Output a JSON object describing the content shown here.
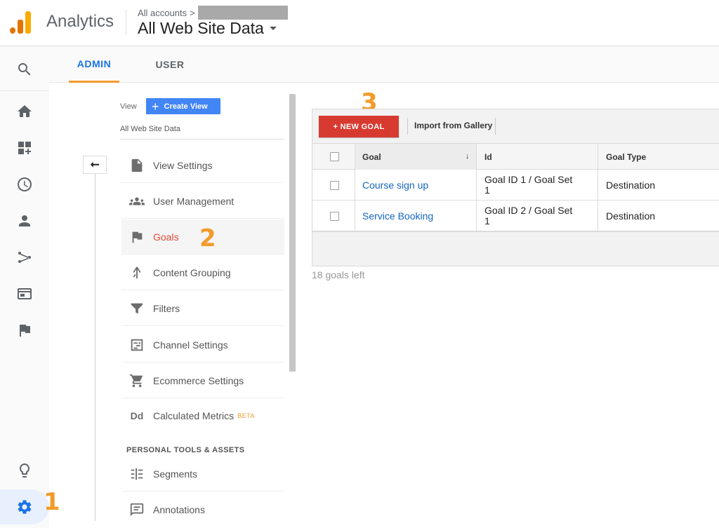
{
  "header": {
    "app_name": "Analytics",
    "breadcrumb": "All accounts",
    "breadcrumb_chevron": ">",
    "property_name": "All Web Site Data"
  },
  "brand_colors": {
    "logo_dark": "#e37400",
    "logo_light": "#f9ab00",
    "accent_blue": "#1a73e8",
    "new_goal_red": "#d73b30",
    "step_orange": "#f29b2b"
  },
  "rail": {
    "items": [
      {
        "icon": "search-icon"
      },
      {
        "icon": "home-icon"
      },
      {
        "icon": "customization-icon"
      },
      {
        "icon": "realtime-clock-icon"
      },
      {
        "icon": "audience-person-icon"
      },
      {
        "icon": "acquisition-icon"
      },
      {
        "icon": "behavior-icon"
      },
      {
        "icon": "conversions-flag-icon"
      },
      {
        "icon": "lightbulb-icon"
      },
      {
        "icon": "admin-gear-icon"
      }
    ]
  },
  "tabs": {
    "admin": "ADMIN",
    "user": "USER"
  },
  "view_column": {
    "label": "View",
    "create_button": "Create View",
    "view_name": "All Web Site Data",
    "back_arrow": "⭠",
    "items": [
      {
        "label": "View Settings",
        "icon": "document-icon"
      },
      {
        "label": "User Management",
        "icon": "users-icon"
      },
      {
        "label": "Goals",
        "icon": "flag-icon",
        "active": true
      },
      {
        "label": "Content Grouping",
        "icon": "content-grouping-icon"
      },
      {
        "label": "Filters",
        "icon": "filter-icon"
      },
      {
        "label": "Channel Settings",
        "icon": "channel-settings-icon"
      },
      {
        "label": "Ecommerce Settings",
        "icon": "cart-icon"
      },
      {
        "label": "Calculated Metrics",
        "icon": "dd-icon",
        "badge": "BETA"
      }
    ],
    "section_title": "PERSONAL TOOLS & ASSETS",
    "tool_items": [
      {
        "label": "Segments",
        "icon": "segments-icon"
      },
      {
        "label": "Annotations",
        "icon": "annotation-icon"
      }
    ]
  },
  "goals_panel": {
    "new_goal_button": "+ NEW GOAL",
    "import_button": "Import from Gallery",
    "columns": {
      "goal": "Goal",
      "id": "Id",
      "goal_type": "Goal Type"
    },
    "sort_indicator": "↓",
    "rows": [
      {
        "goal": "Course sign up",
        "id_line1": "Goal ID 1 / Goal Set",
        "id_line2": "1",
        "type": "Destination"
      },
      {
        "goal": "Service Booking",
        "id_line1": "Goal ID 2 / Goal Set",
        "id_line2": "1",
        "type": "Destination"
      }
    ],
    "goals_left": "18 goals left"
  },
  "annotations": {
    "step1": "1",
    "step2": "2",
    "step3": "3"
  },
  "dropdown_caret": "caret-down-icon"
}
